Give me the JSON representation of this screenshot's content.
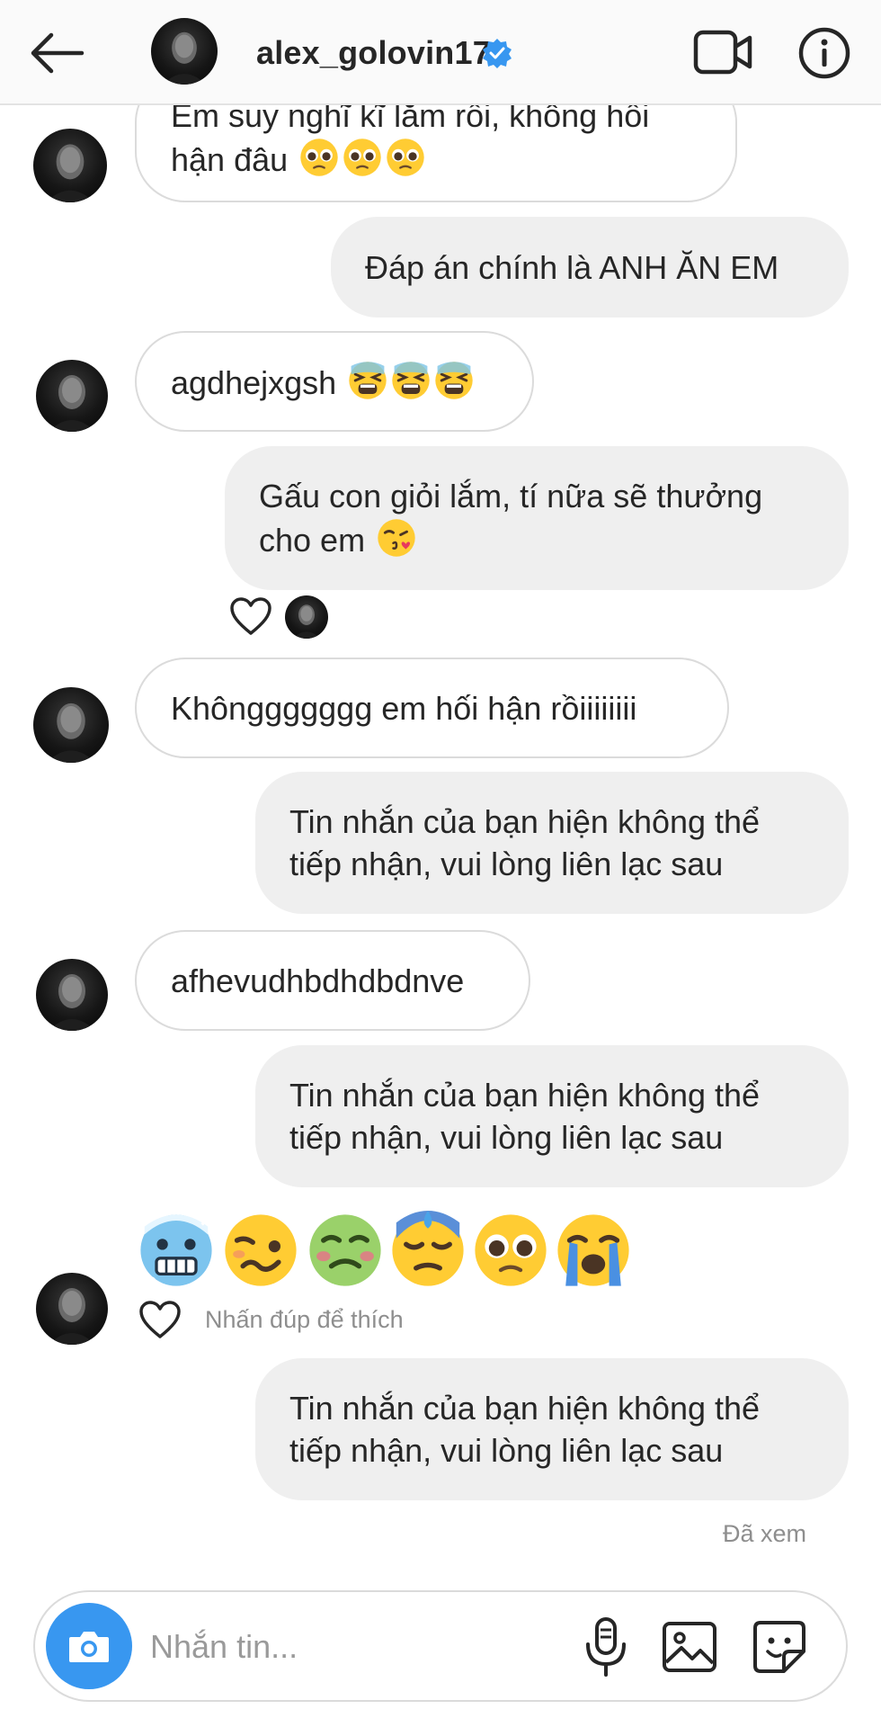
{
  "header": {
    "username": "alex_golovin17",
    "verified": true,
    "icons": [
      "back-arrow-icon",
      "verified-badge-icon",
      "video-call-icon",
      "info-icon"
    ]
  },
  "messages": [
    {
      "side": "in",
      "lines": [
        "Em suy nghĩ kĩ lắm rồi, không hối",
        "hận đâu"
      ],
      "emojis": [
        "pleading-face",
        "pleading-face",
        "pleading-face"
      ]
    },
    {
      "side": "out",
      "lines": [
        "Đáp án chính là ANH ĂN EM"
      ]
    },
    {
      "side": "in",
      "lines": [
        "agdhejxgsh"
      ],
      "emojis": [
        "tired-face",
        "tired-face",
        "tired-face"
      ]
    },
    {
      "side": "out",
      "lines": [
        "Gấu con giỏi lắm, tí nữa sẽ thưởng",
        "cho em"
      ],
      "emojis": [
        "kissing-heart-face"
      ]
    },
    {
      "side": "in",
      "lines": [
        "Khônggggggg em hối hận rồiiiiiiii"
      ]
    },
    {
      "side": "out",
      "lines": [
        "Tin nhắn của bạn hiện không thể",
        "tiếp nhận, vui lòng liên lạc sau"
      ]
    },
    {
      "side": "in",
      "lines": [
        "afhevudhbdhdbdnve"
      ]
    },
    {
      "side": "out",
      "lines": [
        "Tin nhắn của bạn hiện không thể",
        "tiếp nhận, vui lòng liên lạc sau"
      ]
    },
    {
      "side": "in",
      "type": "emoji-only",
      "emojis": [
        "cold-face",
        "woozy-face",
        "nauseated-face",
        "downcast-sweat-face",
        "pleading-face",
        "loudly-crying-face"
      ]
    },
    {
      "side": "out",
      "lines": [
        "Tin nhắn của bạn hiện không thể",
        "tiếp nhận, vui lòng liên lạc sau"
      ]
    }
  ],
  "reactions": {
    "double_tap_hint": "Nhấn đúp để thích"
  },
  "seen_label": "Đã xem",
  "composer": {
    "placeholder": "Nhắn tin...",
    "icons": [
      "camera-icon",
      "microphone-icon",
      "gallery-icon",
      "sticker-icon"
    ]
  },
  "colors": {
    "accent": "#3897f0",
    "verified": "#3897f0",
    "outgoing_bubble": "#efefef",
    "incoming_border": "#dbdbdb",
    "secondary_text": "#8e8e8e"
  }
}
